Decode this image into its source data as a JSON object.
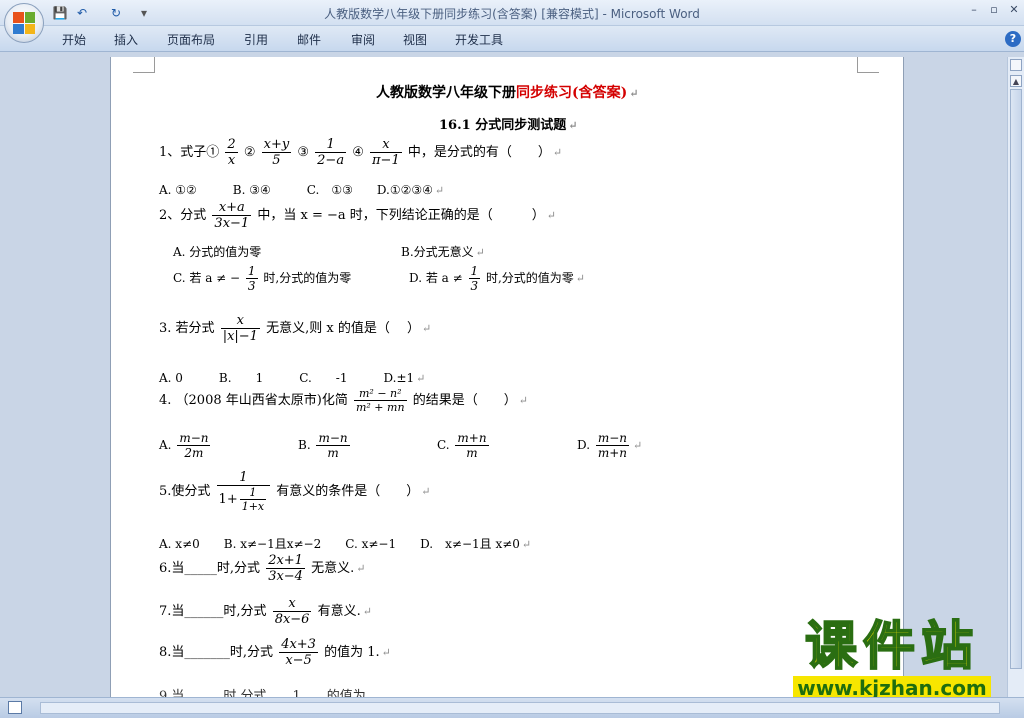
{
  "titlebar": {
    "doc_title": "人教版数学八年级下册同步练习(含答案) [兼容模式] - Microsoft Word",
    "min_glyph": "–",
    "restore_glyph": "▫",
    "close_glyph": "✕",
    "quick_access": {
      "save": "💾",
      "undo": "↶",
      "redo": "↻",
      "customize": "▾"
    }
  },
  "ribbon": {
    "tabs": [
      "开始",
      "插入",
      "页面布局",
      "引用",
      "邮件",
      "审阅",
      "视图",
      "开发工具"
    ],
    "help": "?"
  },
  "document": {
    "title_black": "人教版数学八年级下册",
    "title_red": "同步练习(含答案)",
    "subtitle": "16.1 分式同步测试题",
    "q1": {
      "prefix": "1、式子①",
      "f1n": "2",
      "f1d": "x",
      "c2": "②",
      "f2n": "x+y",
      "f2d": "5",
      "c3": "③",
      "f3n": "1",
      "f3d": "2−a",
      "c4": "④",
      "f4n": "x",
      "f4d": "π−1",
      "suffix": "中，是分式的有（　　）"
    },
    "q1_opts": "A. ①②　　　B. ③④　　　C.　①③　　D.①②③④",
    "q2": {
      "prefix": "2、分式",
      "fn": "x+a",
      "fd": "3x−1",
      "suffix": "中，当 x = −a 时，下列结论正确的是（　　　）"
    },
    "q2_a": "A. 分式的值为零",
    "q2_b": "B.分式无意义",
    "q2_c": {
      "prefix": "C. 若 a ≠ −",
      "fn": "1",
      "fd": "3",
      "suffix": "时,分式的值为零"
    },
    "q2_d": {
      "prefix": "D. 若 a ≠",
      "fn": "1",
      "fd": "3",
      "suffix": "时,分式的值为零"
    },
    "q3": {
      "prefix": "3. 若分式",
      "fn": "x",
      "fd": "|x|−1",
      "suffix": "无意义,则 x 的值是（　 ）"
    },
    "q3_opts": "A. 0　　　B.　　1　　　C.　　-1　　　D.±1",
    "q4": {
      "prefix": "4. （2008 年山西省太原市)化简",
      "fn": "m² − n²",
      "fd": "m² + mn",
      "suffix": "的结果是（　　）"
    },
    "q4_opts": [
      {
        "label": "A.",
        "n": "m−n",
        "d": "2m"
      },
      {
        "label": "B.",
        "n": "m−n",
        "d": "m"
      },
      {
        "label": "C.",
        "n": "m+n",
        "d": "m"
      },
      {
        "label": "D.",
        "n": "m−n",
        "d": "m+n"
      }
    ],
    "q5": {
      "prefix": "5.使分式",
      "fn": "1",
      "fd_pre": "1+",
      "fd_n": "1",
      "fd_d": "1+x",
      "suffix": "有意义的条件是（　　）"
    },
    "q5_opts": "A. x≠0　　B. x≠−1且x≠−2　　C. x≠−1　　D.　x≠−1且 x≠0",
    "q6": {
      "prefix": "6.当_____时,分式",
      "fn": "2x+1",
      "fd": "3x−4",
      "suffix": "无意义."
    },
    "q7": {
      "prefix": "7.当______时,分式",
      "fn": "x",
      "fd": "8x−6",
      "suffix": "有意义."
    },
    "q8": {
      "prefix": "8.当_______时,分式",
      "fn": "4x+3",
      "fd": "x−5",
      "suffix": "的值为 1."
    },
    "q9_partial": "9.当　　　时,分式　　1　　的值为"
  },
  "watermark": {
    "title": "课件站",
    "url": "www.kjzhan.com"
  },
  "colors": {
    "accent_red": "#d40000",
    "watermark_yellow": "#f7e600",
    "watermark_green": "#2a6e12"
  }
}
